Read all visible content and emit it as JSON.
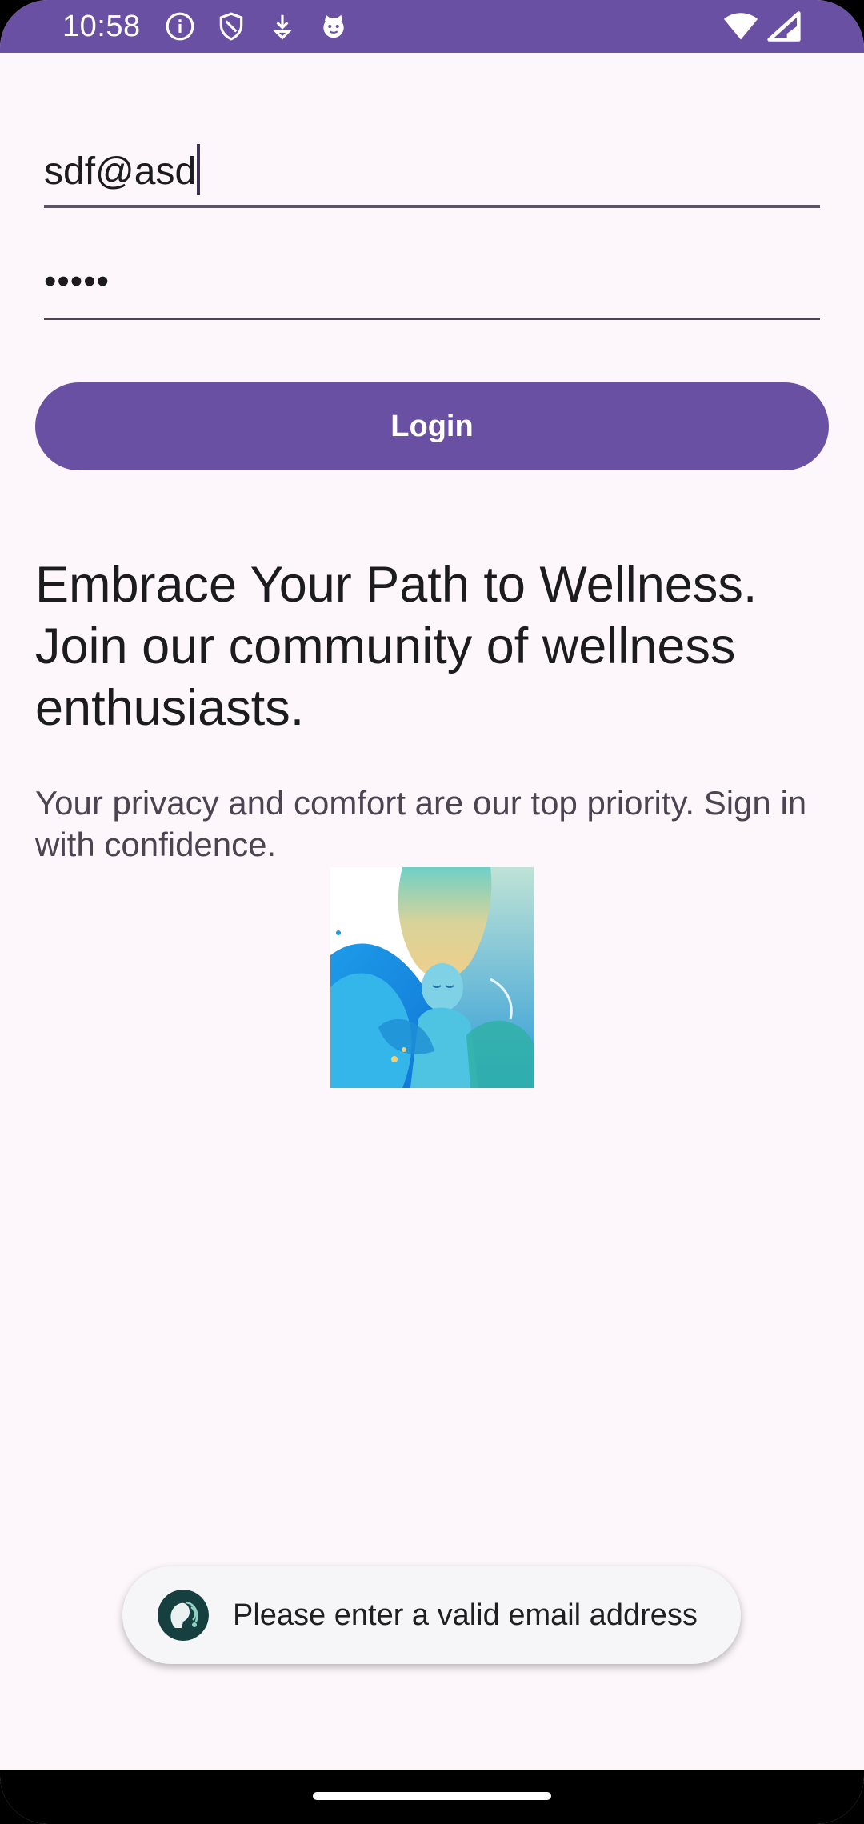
{
  "status_bar": {
    "time": "10:58",
    "left_icons": [
      "info-icon",
      "shield-icon",
      "download-icon",
      "cat-face-icon"
    ],
    "right_icons": [
      "wifi-icon",
      "cellular-signal-icon"
    ]
  },
  "form": {
    "email_value": "sdf@asd",
    "password_value": "•••••",
    "login_label": "Login"
  },
  "content": {
    "headline": "Embrace Your Path to Wellness. Join our community of wellness enthusiasts.",
    "subtext": "Your privacy and comfort are our top priority. Sign in with confidence."
  },
  "toast": {
    "message": "Please enter a valid email address"
  },
  "colors": {
    "primary": "#6a50a2",
    "background": "#fdf7fb",
    "toast_background": "#f6f6f8"
  }
}
